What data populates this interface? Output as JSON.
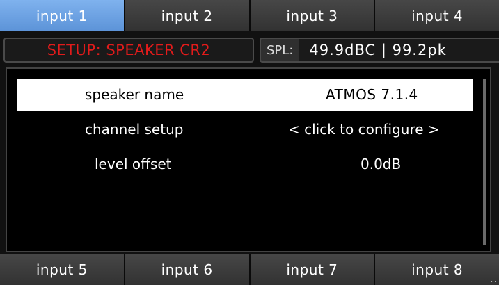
{
  "top_tabs": [
    {
      "label": "input 1",
      "active": true
    },
    {
      "label": "input 2",
      "active": false
    },
    {
      "label": "input 3",
      "active": false
    },
    {
      "label": "input 4",
      "active": false
    }
  ],
  "status": {
    "title": "SETUP: SPEAKER CR2",
    "spl_label": "SPL:",
    "spl_value": "49.9dBC | 99.2pk"
  },
  "rows": [
    {
      "label": "speaker name",
      "value": "ATMOS 7.1.4",
      "selected": true
    },
    {
      "label": "channel setup",
      "value": "< click to configure >",
      "selected": false
    },
    {
      "label": "level offset",
      "value": "0.0dB",
      "selected": false
    }
  ],
  "bottom_tabs": [
    {
      "label": "input 5"
    },
    {
      "label": "input 6"
    },
    {
      "label": "input 7"
    },
    {
      "label": "input 8"
    }
  ],
  "more_indicator": "..",
  "colors": {
    "active_tab": "#6fa3e6",
    "title_red": "#e21b1b",
    "tab_bg": "#3c3c3c"
  }
}
